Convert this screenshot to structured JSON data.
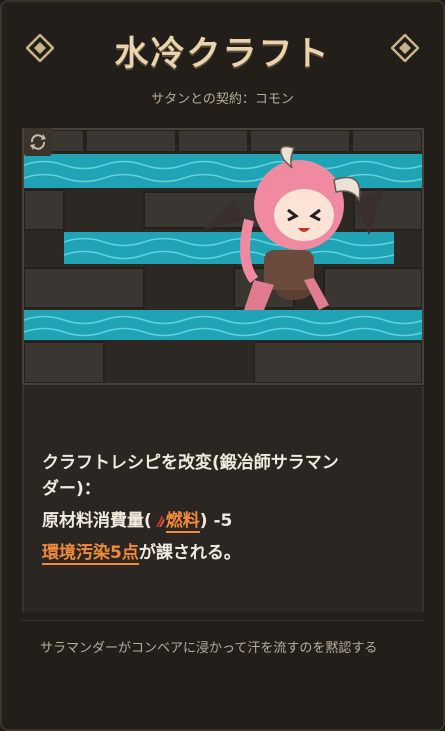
{
  "card": {
    "title": "水冷クラフト",
    "subtitle": "サタンとの契約：コモン"
  },
  "description": {
    "line1": "クラフトレシピを改変(鍛冶師サラマン",
    "line2": "ダー)：",
    "line3_prefix": "原材料消費量(",
    "line3_fuel": "燃料",
    "line3_suffix": ") -5",
    "line4_highlight": "環境汚染5点",
    "line4_suffix": "が課される。"
  },
  "flavor": {
    "text": "サラマンダーがコンベアに浸かって汗を流すのを黙認する"
  },
  "colors": {
    "accent": "#f28a3a",
    "title": "#e9d4ad",
    "water": "#2fb6c7"
  }
}
